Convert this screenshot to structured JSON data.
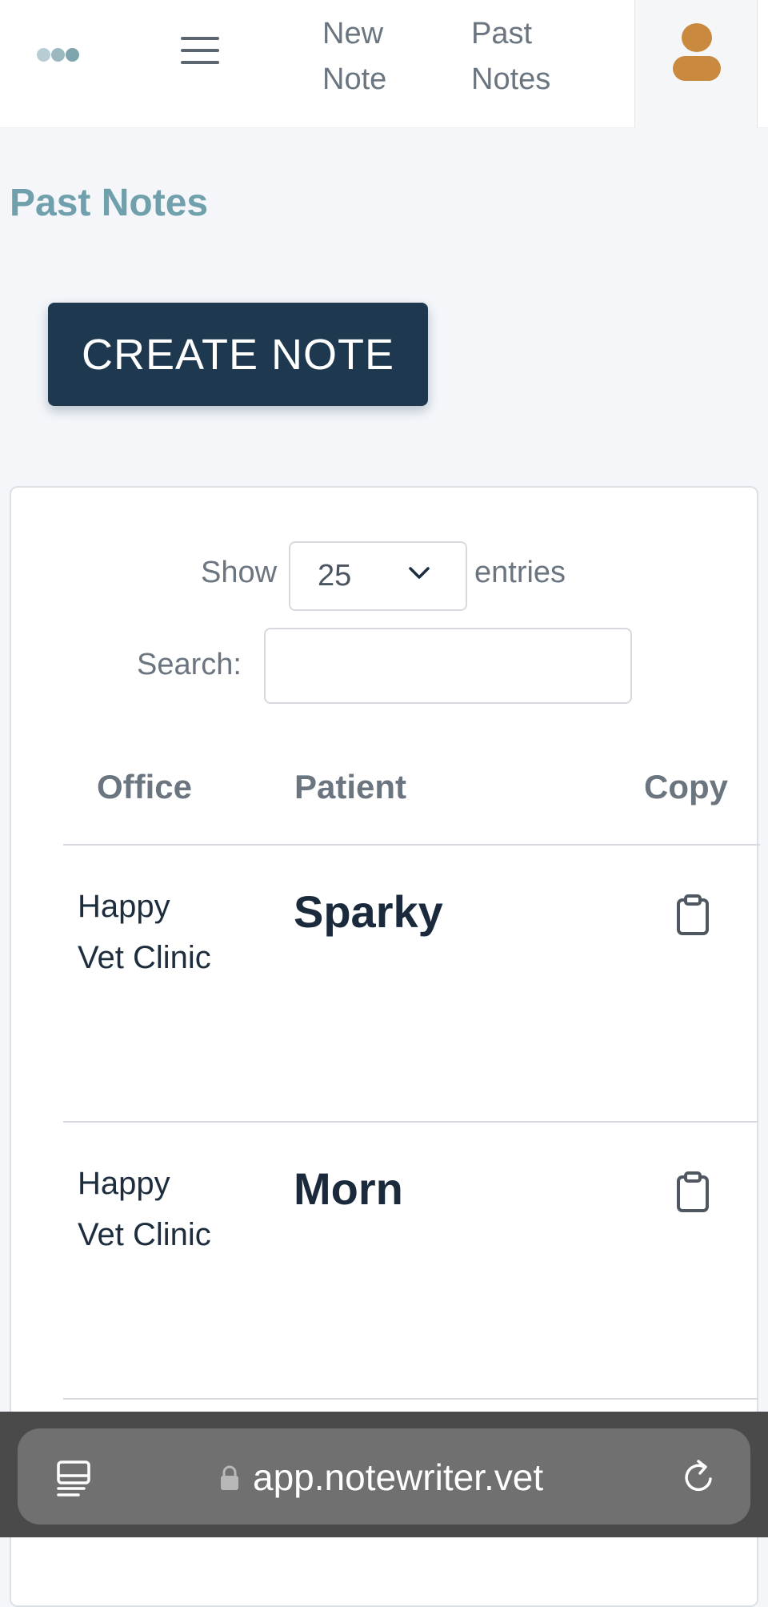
{
  "nav": {
    "logo_icon": "dots-logo-icon",
    "menu_icon": "hamburger-icon",
    "links": [
      {
        "label_line1": "New",
        "label_line2": "Note"
      },
      {
        "label_line1": "Past",
        "label_line2": "Notes"
      }
    ],
    "avatar_icon": "user-avatar-icon",
    "colors": {
      "accent": "#c98a3f",
      "logo_dots": [
        "#b7ccd3",
        "#9bb8c1",
        "#7ea4ae"
      ]
    }
  },
  "page": {
    "title": "Past Notes",
    "create_button_label": "CREATE NOTE"
  },
  "table_controls": {
    "show_label": "Show",
    "entries_value": "25",
    "entries_label": "entries",
    "search_label": "Search:",
    "search_value": ""
  },
  "table": {
    "columns": [
      "Office",
      "Patient",
      "Copy"
    ],
    "rows": [
      {
        "office_line1": "Happy",
        "office_line2": "Vet Clinic",
        "patient": "Sparky",
        "copy_icon": "clipboard-icon"
      },
      {
        "office_line1": "Happy",
        "office_line2": "Vet Clinic",
        "patient": "Morn",
        "copy_icon": "clipboard-icon"
      }
    ]
  },
  "browser": {
    "url": "app.notewriter.vet",
    "tabs_icon": "tabs-icon",
    "lock_icon": "lock-icon",
    "reload_icon": "reload-icon"
  },
  "colors": {
    "title": "#6fa0ab",
    "button_bg": "#1e394f",
    "page_bg": "#f4f6fa"
  }
}
